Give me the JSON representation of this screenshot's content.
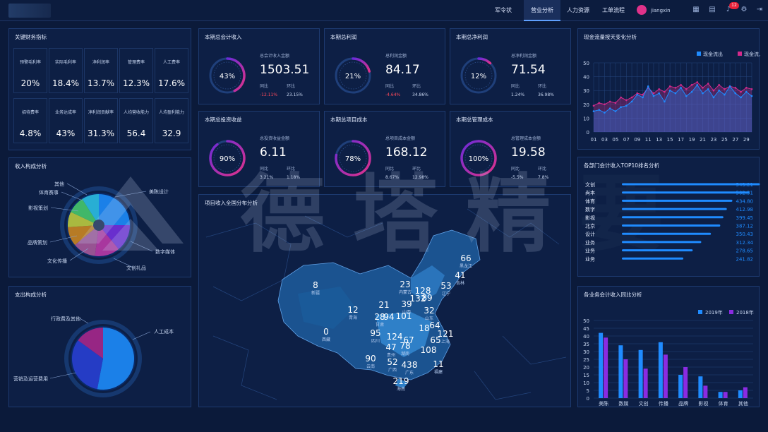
{
  "nav": {
    "items": [
      {
        "label": "军令状"
      },
      {
        "label": "营业分析"
      },
      {
        "label": "人力资源"
      },
      {
        "label": "工单流程"
      }
    ],
    "active_index": 1,
    "user": "jiangxin",
    "notification_count": "12"
  },
  "kpi": {
    "title": "关键财务指标",
    "cells": [
      {
        "label": "预警毛利率",
        "value": "20%"
      },
      {
        "label": "实际毛利率",
        "value": "18.4%"
      },
      {
        "label": "净利润率",
        "value": "13.7%"
      },
      {
        "label": "管理费率",
        "value": "12.3%"
      },
      {
        "label": "人工费率",
        "value": "17.6%"
      },
      {
        "label": "招待费率",
        "value": "4.8%"
      },
      {
        "label": "业务达成率",
        "value": "43%"
      },
      {
        "label": "净利润贡献率",
        "value": "31.3%"
      },
      {
        "label": "人均营收能力",
        "value": "56.4"
      },
      {
        "label": "人均盈利能力",
        "value": "32.9"
      }
    ]
  },
  "stats": [
    {
      "title": "本期总会计收入",
      "caption": "总会计收入金额",
      "value": "1503.51",
      "pct": "43%",
      "fraction": 0.43,
      "yoy_label": "同比",
      "yoy": "-12.11%",
      "yoy_neg": true,
      "mom_label": "环比",
      "mom": "23.15%"
    },
    {
      "title": "本期总利润",
      "caption": "总利润金额",
      "value": "84.17",
      "pct": "21%",
      "fraction": 0.21,
      "yoy_label": "同比",
      "yoy": "-4.64%",
      "yoy_neg": true,
      "mom_label": "环比",
      "mom": "34.86%"
    },
    {
      "title": "本期总净利润",
      "caption": "总净利润金额",
      "value": "71.54",
      "pct": "12%",
      "fraction": 0.12,
      "yoy_label": "同比",
      "yoy": "1.24%",
      "yoy_neg": false,
      "mom_label": "环比",
      "mom": "36.98%"
    },
    {
      "title": "本期总投资收益",
      "caption": "总投资收益金额",
      "value": "6.11",
      "pct": "90%",
      "fraction": 0.9,
      "yoy_label": "同比",
      "yoy": "3.21%",
      "yoy_neg": false,
      "mom_label": "环比",
      "mom": "1.18%"
    },
    {
      "title": "本期总项目成本",
      "caption": "总项目成本金额",
      "value": "168.12",
      "pct": "78%",
      "fraction": 0.78,
      "yoy_label": "同比",
      "yoy": "8.67%",
      "yoy_neg": false,
      "mom_label": "环比",
      "mom": "12.98%"
    },
    {
      "title": "本期总管理成本",
      "caption": "总管理成本金额",
      "value": "19.58",
      "pct": "100%",
      "fraction": 1.0,
      "yoy_label": "同比",
      "yoy": "-5.5%",
      "yoy_neg": false,
      "mom_label": "环比",
      "mom": "7.8%"
    }
  ],
  "income_pie": {
    "title": "收入构成分析",
    "labels": [
      "其他",
      "体育赛事",
      "影视策划",
      "品牌策划",
      "文化传播",
      "文创礼品",
      "数字媒体",
      "美陈设计"
    ]
  },
  "expense_pie": {
    "title": "支出构成分析",
    "labels": [
      "行政费及其他",
      "人工成本",
      "营销及运营费用"
    ]
  },
  "map": {
    "title": "项目收入全国分布分析",
    "watermark": "德塔精要",
    "points": [
      {
        "v": "66",
        "name": "黑龙江"
      },
      {
        "v": "41",
        "name": "吉林"
      },
      {
        "v": "53",
        "name": "辽宁"
      },
      {
        "v": "8",
        "name": "新疆"
      },
      {
        "v": "23",
        "name": "内蒙古"
      },
      {
        "v": "128",
        "name": ""
      },
      {
        "v": "132",
        "name": ""
      },
      {
        "v": "89",
        "name": ""
      },
      {
        "v": "12",
        "name": "青海"
      },
      {
        "v": "21",
        "name": ""
      },
      {
        "v": "39",
        "name": "山西"
      },
      {
        "v": "28",
        "name": "甘肃"
      },
      {
        "v": "94",
        "name": ""
      },
      {
        "v": "101",
        "name": ""
      },
      {
        "v": "32",
        "name": "山东"
      },
      {
        "v": "0",
        "name": "西藏"
      },
      {
        "v": "95",
        "name": "四川"
      },
      {
        "v": "124",
        "name": ""
      },
      {
        "v": "18",
        "name": ""
      },
      {
        "v": "64",
        "name": ""
      },
      {
        "v": "121",
        "name": "上海"
      },
      {
        "v": "67",
        "name": ""
      },
      {
        "v": "65",
        "name": ""
      },
      {
        "v": "47",
        "name": "贵州"
      },
      {
        "v": "78",
        "name": "湖南"
      },
      {
        "v": "108",
        "name": ""
      },
      {
        "v": "90",
        "name": "云南"
      },
      {
        "v": "52",
        "name": "广西"
      },
      {
        "v": "438",
        "name": "广东"
      },
      {
        "v": "11",
        "name": "福建"
      },
      {
        "v": "219",
        "name": "海南"
      }
    ]
  },
  "chart_data": [
    {
      "type": "line",
      "title": "现金流量按天变化分析",
      "legend": [
        "现金流出",
        "现金流入"
      ],
      "x": [
        "01",
        "03",
        "05",
        "07",
        "09",
        "11",
        "13",
        "15",
        "17",
        "19",
        "21",
        "23",
        "25",
        "27",
        "29"
      ],
      "ylim": [
        0,
        50
      ],
      "yticks": [
        0,
        10,
        20,
        30,
        40,
        50
      ],
      "series": [
        {
          "name": "现金流出",
          "color": "#1f8bff",
          "values": [
            15,
            16,
            14,
            17,
            15,
            18,
            19,
            22,
            27,
            25,
            33,
            26,
            28,
            22,
            30,
            28,
            32,
            26,
            29,
            34,
            28,
            31,
            25,
            30,
            27,
            33,
            28,
            25,
            29,
            26
          ]
        },
        {
          "name": "现金流入",
          "color": "#d42a8c",
          "values": [
            19,
            21,
            20,
            22,
            21,
            25,
            23,
            25,
            28,
            27,
            32,
            28,
            31,
            29,
            33,
            32,
            34,
            31,
            34,
            36,
            32,
            35,
            30,
            34,
            31,
            33,
            32,
            29,
            32,
            31
          ]
        }
      ]
    },
    {
      "type": "bar",
      "title": "各部门会计收入TOP10排名分析",
      "categories": [
        "文创",
        "尚本",
        "体育",
        "数字",
        "影视",
        "北京",
        "设计",
        "业务",
        "业务",
        "业务"
      ],
      "values": [
        543.21,
        502.31,
        434.8,
        412.98,
        399.45,
        387.12,
        350.43,
        312.34,
        278.65,
        241.82
      ],
      "value_labels": [
        "543.21",
        "502.31",
        "434.80",
        "412.98",
        "399.45",
        "387.12",
        "350.43",
        "312.34",
        "278.65",
        "241.82"
      ],
      "xlim": [
        0,
        600
      ]
    },
    {
      "type": "bar",
      "title": "各业务会计收入同比分析",
      "categories": [
        "美陈",
        "数媒",
        "文创",
        "传播",
        "品牌",
        "影视",
        "体育",
        "其他"
      ],
      "ylim": [
        0,
        50
      ],
      "yticks": [
        0,
        5,
        10,
        15,
        20,
        25,
        30,
        35,
        40,
        45,
        50
      ],
      "series": [
        {
          "name": "2019年",
          "color": "#1f8bff",
          "values": [
            42,
            34,
            31,
            36,
            15,
            14,
            4,
            5
          ]
        },
        {
          "name": "2018年",
          "color": "#8a2be2",
          "values": [
            39,
            25,
            19,
            28,
            20,
            8,
            4,
            7
          ]
        }
      ]
    }
  ]
}
